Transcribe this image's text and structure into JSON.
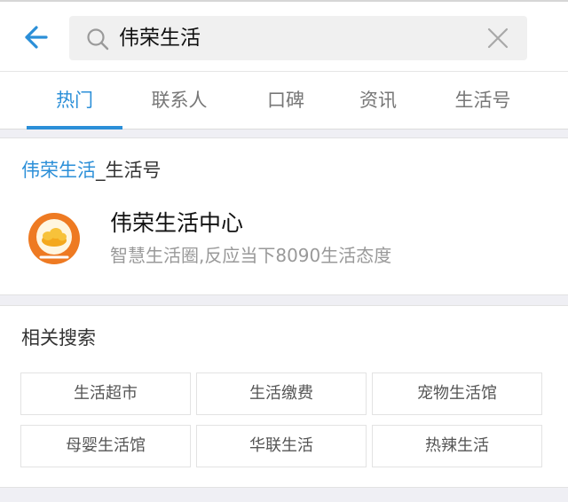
{
  "header": {
    "back_icon": "back-arrow-icon",
    "search_icon": "search-icon",
    "search_value": "伟荣生活",
    "clear_icon": "close-icon",
    "accent_color": "#2b8fd8"
  },
  "tabs": [
    {
      "label": "热门",
      "active": true
    },
    {
      "label": "联系人",
      "active": false
    },
    {
      "label": "口碑",
      "active": false
    },
    {
      "label": "资讯",
      "active": false
    },
    {
      "label": "生活号",
      "active": false
    }
  ],
  "life_section": {
    "title_highlight": "伟荣生活",
    "title_rest": "_生活号",
    "account": {
      "name": "伟荣生活中心",
      "description": "智慧生活圈,反应当下8090生活态度",
      "logo_icon": "life-account-logo-icon"
    }
  },
  "related": {
    "title": "相关搜索",
    "items": [
      "生活超市",
      "生活缴费",
      "宠物生活馆",
      "母婴生活馆",
      "华联生活",
      "热辣生活"
    ]
  }
}
